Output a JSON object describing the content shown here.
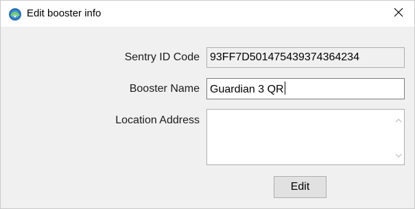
{
  "window": {
    "title": "Edit booster info",
    "app_icon": "booster-app-icon",
    "close_icon": "close-icon"
  },
  "form": {
    "sentry_id": {
      "label": "Sentry ID Code",
      "value": "93FF7D501475439374364234"
    },
    "booster_name": {
      "label": "Booster Name",
      "value": "Guardian 3 QR"
    },
    "location_address": {
      "label": "Location Address",
      "value": "",
      "scroll_up_icon": "chevron-up-icon",
      "scroll_down_icon": "chevron-down-icon"
    }
  },
  "actions": {
    "edit_label": "Edit"
  },
  "colors": {
    "window_bg": "#f0f0f0",
    "titlebar_bg": "#ffffff",
    "button_bg": "#e1e1e1",
    "border": "#adadad"
  }
}
